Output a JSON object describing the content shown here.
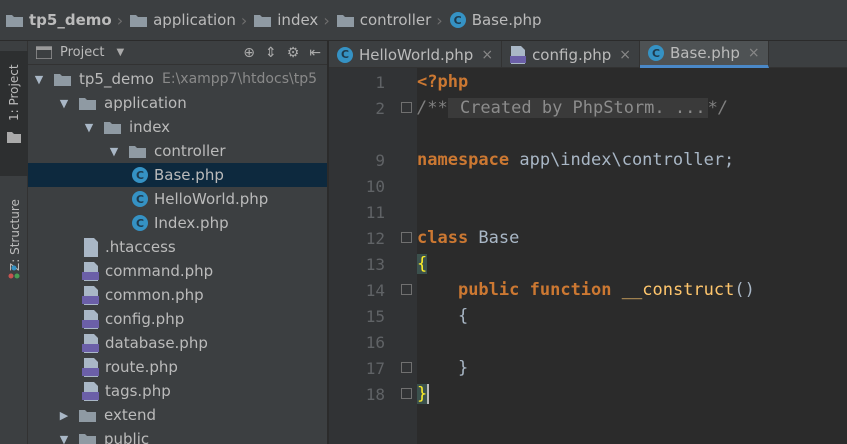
{
  "breadcrumb": {
    "items": [
      "tp5_demo",
      "application",
      "index",
      "controller",
      "Base.php"
    ]
  },
  "tool_strip": {
    "project_tab": "1: Project",
    "structure_tab": "Z: Structure"
  },
  "project_panel": {
    "title": "Project",
    "root_path": "E:\\xampp7\\htdocs\\tp5",
    "tree": [
      {
        "label": "tp5_demo",
        "type": "folder",
        "expanded": true
      },
      {
        "label": "application",
        "type": "folder",
        "expanded": true
      },
      {
        "label": "index",
        "type": "folder",
        "expanded": true
      },
      {
        "label": "controller",
        "type": "folder",
        "expanded": true
      },
      {
        "label": "Base.php",
        "type": "php-class",
        "selected": true
      },
      {
        "label": "HelloWorld.php",
        "type": "php-class"
      },
      {
        "label": "Index.php",
        "type": "php-class"
      },
      {
        "label": ".htaccess",
        "type": "file"
      },
      {
        "label": "command.php",
        "type": "php"
      },
      {
        "label": "common.php",
        "type": "php"
      },
      {
        "label": "config.php",
        "type": "php"
      },
      {
        "label": "database.php",
        "type": "php"
      },
      {
        "label": "route.php",
        "type": "php"
      },
      {
        "label": "tags.php",
        "type": "php"
      },
      {
        "label": "extend",
        "type": "folder",
        "expanded": false
      },
      {
        "label": "public",
        "type": "folder",
        "expanded": true
      }
    ]
  },
  "editor_tabs": [
    {
      "label": "HelloWorld.php",
      "close": "×"
    },
    {
      "label": "config.php",
      "close": "×"
    },
    {
      "label": "Base.php",
      "close": "×",
      "active": true
    }
  ],
  "editor": {
    "line_numbers": [
      "1",
      "2",
      "9",
      "10",
      "11",
      "12",
      "13",
      "14",
      "15",
      "16",
      "17",
      "18"
    ],
    "lines": {
      "l1": "<?php",
      "l2_open": "/**",
      "l2_fold": " Created by PhpStorm. ...",
      "l2_close": "*/",
      "l9_kw": "namespace",
      "l9_rest": " app\\index\\controller;",
      "l12_kw": "class",
      "l12_rest": " Base",
      "l13": "{",
      "l14_kw1": "public",
      "l14_kw2": "function",
      "l14_name": "__construct",
      "l14_rest": "()",
      "l15": "{",
      "l17": "}",
      "l18": "}"
    }
  },
  "colors": {
    "background": "#2b2b2b",
    "keyword": "#cc7832",
    "comment": "#808080",
    "selection": "#0d293e",
    "active_tab_underline": "#4a88c7"
  }
}
